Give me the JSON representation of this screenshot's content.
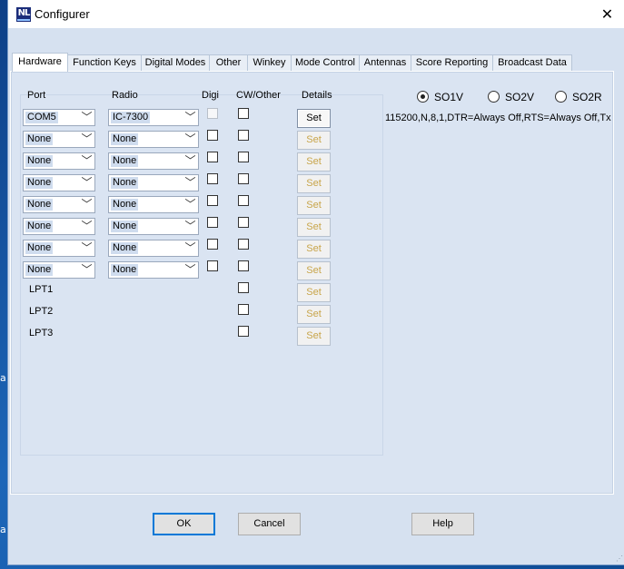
{
  "window": {
    "title": "Configurer",
    "app_icon_text": "NL"
  },
  "tabs": [
    {
      "label": "Hardware",
      "active": true
    },
    {
      "label": "Function Keys"
    },
    {
      "label": "Digital Modes"
    },
    {
      "label": "Other"
    },
    {
      "label": "Winkey"
    },
    {
      "label": "Mode Control"
    },
    {
      "label": "Antennas"
    },
    {
      "label": "Score Reporting"
    },
    {
      "label": "Broadcast Data"
    }
  ],
  "headers": {
    "port": "Port",
    "radio": "Radio",
    "digi": "Digi",
    "cw": "CW/Other",
    "details": "Details"
  },
  "rows": [
    {
      "port": "COM5",
      "radio": "IC-7300",
      "digi": false,
      "digi_disabled": true,
      "cw": false,
      "set": "Set",
      "set_enabled": true
    },
    {
      "port": "None",
      "radio": "None",
      "digi": false,
      "cw": false,
      "set": "Set",
      "set_enabled": false
    },
    {
      "port": "None",
      "radio": "None",
      "digi": false,
      "cw": false,
      "set": "Set",
      "set_enabled": false
    },
    {
      "port": "None",
      "radio": "None",
      "digi": false,
      "cw": false,
      "set": "Set",
      "set_enabled": false
    },
    {
      "port": "None",
      "radio": "None",
      "digi": false,
      "cw": false,
      "set": "Set",
      "set_enabled": false
    },
    {
      "port": "None",
      "radio": "None",
      "digi": false,
      "cw": false,
      "set": "Set",
      "set_enabled": false
    },
    {
      "port": "None",
      "radio": "None",
      "digi": false,
      "cw": false,
      "set": "Set",
      "set_enabled": false
    },
    {
      "port": "None",
      "radio": "None",
      "digi": false,
      "cw": false,
      "set": "Set",
      "set_enabled": false
    }
  ],
  "lpt_rows": [
    {
      "label": "LPT1",
      "cw": false,
      "set": "Set"
    },
    {
      "label": "LPT2",
      "cw": false,
      "set": "Set"
    },
    {
      "label": "LPT3",
      "cw": false,
      "set": "Set"
    }
  ],
  "operation": {
    "options": [
      {
        "label": "SO1V",
        "selected": true
      },
      {
        "label": "SO2V",
        "selected": false
      },
      {
        "label": "SO2R",
        "selected": false
      }
    ]
  },
  "detail_text": "115200,N,8,1,DTR=Always Off,RTS=Always Off,Tx",
  "buttons": {
    "ok": "OK",
    "cancel": "Cancel",
    "help": "Help"
  },
  "desktop": {
    "glyph_a": "a",
    "glyph_b": "a"
  },
  "icons": {
    "close": "close-icon",
    "dropdown": "chevron-down-icon",
    "app": "n1mm-logo-icon"
  },
  "colors": {
    "dialog_bg": "#d6e1f0",
    "default_button_border": "#0078d7"
  }
}
